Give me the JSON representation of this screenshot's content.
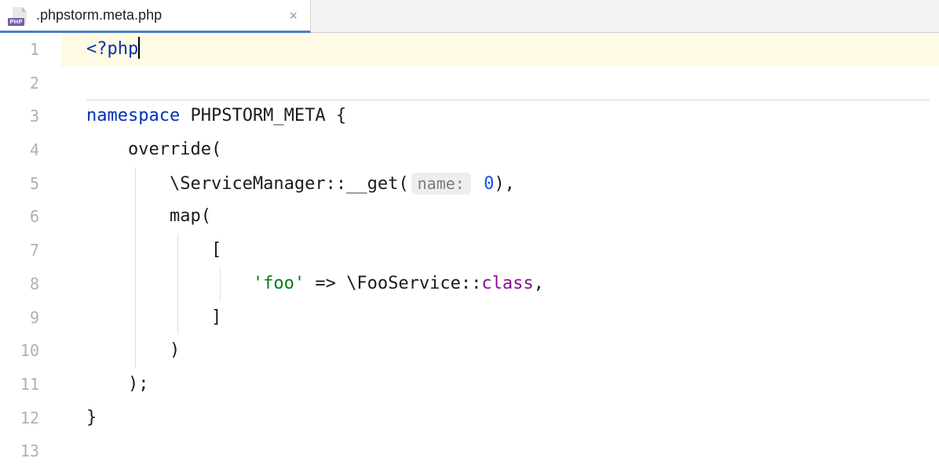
{
  "tab": {
    "filename": ".phpstorm.meta.php",
    "icon_label": "PHP"
  },
  "gutter": {
    "lines": [
      "1",
      "2",
      "3",
      "4",
      "5",
      "6",
      "7",
      "8",
      "9",
      "10",
      "11",
      "12",
      "13"
    ]
  },
  "code": {
    "line1": {
      "open_tag": "<?php"
    },
    "line3": {
      "kw_namespace": "namespace",
      "ns_name": "PHPSTORM_META",
      "brace": " {"
    },
    "line4": {
      "fn": "override("
    },
    "line5": {
      "cls": "\\ServiceManager",
      "method": "::__get(",
      "hint": "name:",
      "num": "0",
      "close": "),",
      "space": " "
    },
    "line6": {
      "fn": "map("
    },
    "line7": {
      "bracket": "["
    },
    "line8": {
      "str": "'foo'",
      "arrow": " => ",
      "cls": "\\FooService",
      "sep": "::",
      "const": "class",
      "comma": ","
    },
    "line9": {
      "bracket": "]"
    },
    "line10": {
      "paren": ")"
    },
    "line11": {
      "close": ");"
    },
    "line12": {
      "brace": "}"
    }
  }
}
